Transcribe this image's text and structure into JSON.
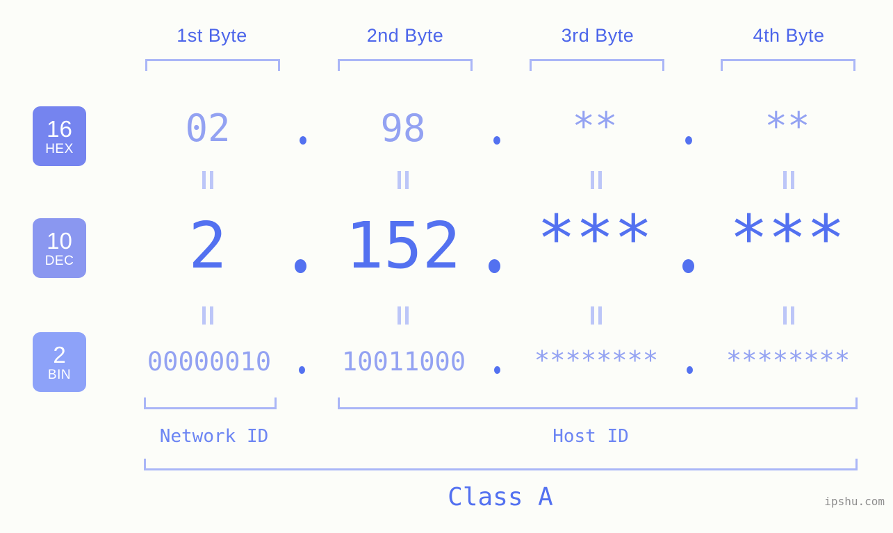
{
  "meta": {
    "background_color": "#fcfdf9",
    "accent_strong": "#5371f0",
    "accent_light": "#93a2f2",
    "bracket_color": "#aab6f7",
    "watermark": "ipshu.com"
  },
  "byte_headers": [
    {
      "label": "1st Byte"
    },
    {
      "label": "2nd Byte"
    },
    {
      "label": "3rd Byte"
    },
    {
      "label": "4th Byte"
    }
  ],
  "bases": [
    {
      "num": "16",
      "abbr": "HEX",
      "color": "#7584ef"
    },
    {
      "num": "10",
      "abbr": "DEC",
      "color": "#8a97f0"
    },
    {
      "num": "2",
      "abbr": "BIN",
      "color": "#8da2f9"
    }
  ],
  "rows": {
    "hex": {
      "values": [
        "02",
        "98",
        "**",
        "**"
      ],
      "separator": "."
    },
    "dec": {
      "values": [
        "2",
        "152",
        "***",
        "***"
      ],
      "separator": "."
    },
    "bin": {
      "values": [
        "00000010",
        "10011000",
        "********",
        "********"
      ],
      "separator": "."
    }
  },
  "sections": [
    {
      "label": "Network ID"
    },
    {
      "label": "Host ID"
    }
  ],
  "class": {
    "label": "Class A"
  },
  "connector": {
    "glyph": "||"
  }
}
